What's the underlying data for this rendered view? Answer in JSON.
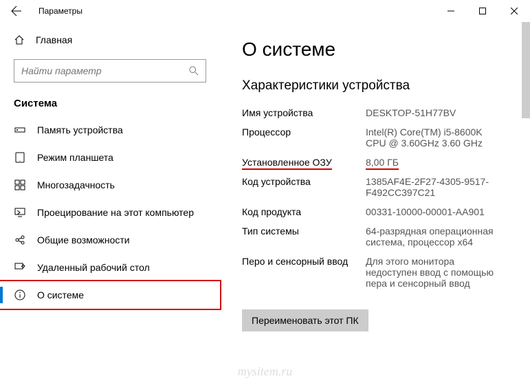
{
  "titlebar": {
    "title": "Параметры"
  },
  "sidebar": {
    "home": "Главная",
    "search_placeholder": "Найти параметр",
    "section": "Система",
    "items": [
      {
        "label": "Память устройства"
      },
      {
        "label": "Режим планшета"
      },
      {
        "label": "Многозадачность"
      },
      {
        "label": "Проецирование на этот компьютер"
      },
      {
        "label": "Общие возможности"
      },
      {
        "label": "Удаленный рабочий стол"
      },
      {
        "label": "О системе"
      }
    ]
  },
  "main": {
    "heading": "О системе",
    "subheading": "Характеристики устройства",
    "specs": {
      "device_name_label": "Имя устройства",
      "device_name_value": "DESKTOP-51H77BV",
      "processor_label": "Процессор",
      "processor_value": "Intel(R) Core(TM) i5-8600K CPU @ 3.60GHz   3.60 GHz",
      "ram_label": "Установленное ОЗУ",
      "ram_value": "8,00 ГБ",
      "device_id_label": "Код устройства",
      "device_id_value": "1385AF4E-2F27-4305-9517-F492CC397C21",
      "product_id_label": "Код продукта",
      "product_id_value": "00331-10000-00001-AA901",
      "system_type_label": "Тип системы",
      "system_type_value": "64-разрядная операционная система, процессор x64",
      "pen_label": "Перо и сенсорный ввод",
      "pen_value": "Для этого монитора недоступен ввод с помощью пера и сенсорный ввод"
    },
    "rename_button": "Переименовать этот ПК"
  },
  "watermark": "mysitem.ru"
}
